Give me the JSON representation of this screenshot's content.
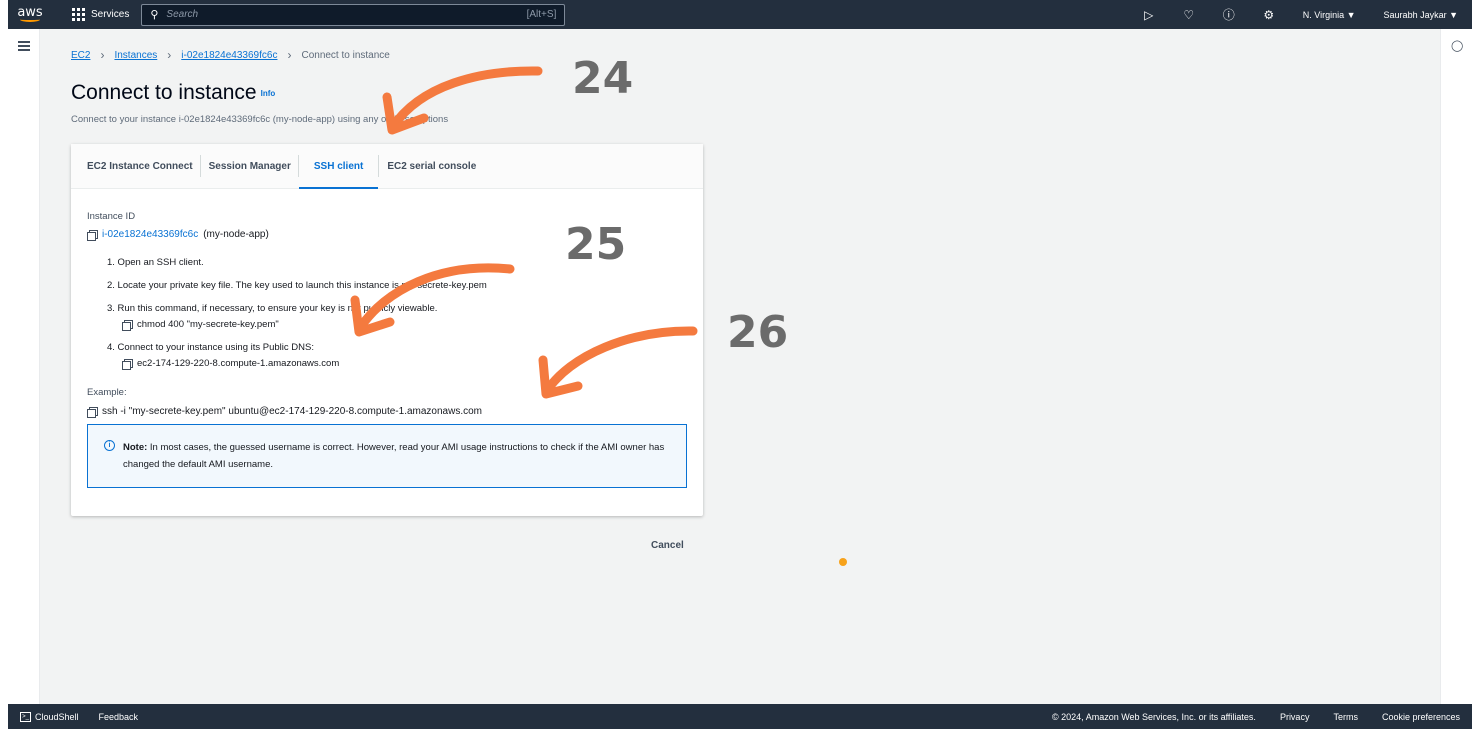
{
  "topbar": {
    "logo": "aws",
    "services": "Services",
    "search_placeholder": "Search",
    "search_shortcut": "[Alt+S]",
    "region": "N. Virginia ▼",
    "user": "Saurabh Jaykar ▼"
  },
  "breadcrumb": [
    "EC2",
    "Instances",
    "i-02e1824e43369fc6c",
    "Connect to instance"
  ],
  "page": {
    "title": "Connect to instance",
    "info": "Info",
    "subtitle": "Connect to your instance i-02e1824e43369fc6c (my-node-app) using any of these options"
  },
  "tabs": [
    "EC2 Instance Connect",
    "Session Manager",
    "SSH client",
    "EC2 serial console"
  ],
  "active_tab": "SSH client",
  "ssh": {
    "instance_id_label": "Instance ID",
    "instance_id": "i-02e1824e43369fc6c",
    "instance_name": "(my-node-app)",
    "step1": "1. Open an SSH client.",
    "step2": "2. Locate your private key file. The key used to launch this instance is my-secrete-key.pem",
    "step3": "3. Run this command, if necessary, to ensure your key is not publicly viewable.",
    "step3_cmd": "chmod 400 \"my-secrete-key.pem\"",
    "step4": "4. Connect to your instance using its Public DNS:",
    "step4_cmd": "ec2-174-129-220-8.compute-1.amazonaws.com",
    "example_label": "Example:",
    "example_cmd": "ssh -i \"my-secrete-key.pem\" ubuntu@ec2-174-129-220-8.compute-1.amazonaws.com",
    "note_bold": "Note:",
    "note_text": "In most cases, the guessed username is correct. However, read your AMI usage instructions to check if the AMI owner has changed the default AMI username."
  },
  "cancel": "Cancel",
  "footer": {
    "cloudshell": "CloudShell",
    "feedback": "Feedback",
    "copyright": "© 2024, Amazon Web Services, Inc. or its affiliates.",
    "privacy": "Privacy",
    "terms": "Terms",
    "cookies": "Cookie preferences"
  },
  "annotations": [
    "24",
    "25",
    "26"
  ],
  "colors": {
    "accent": "#0972d3",
    "arrow": "#f47a3f",
    "nav": "#232f3e"
  }
}
